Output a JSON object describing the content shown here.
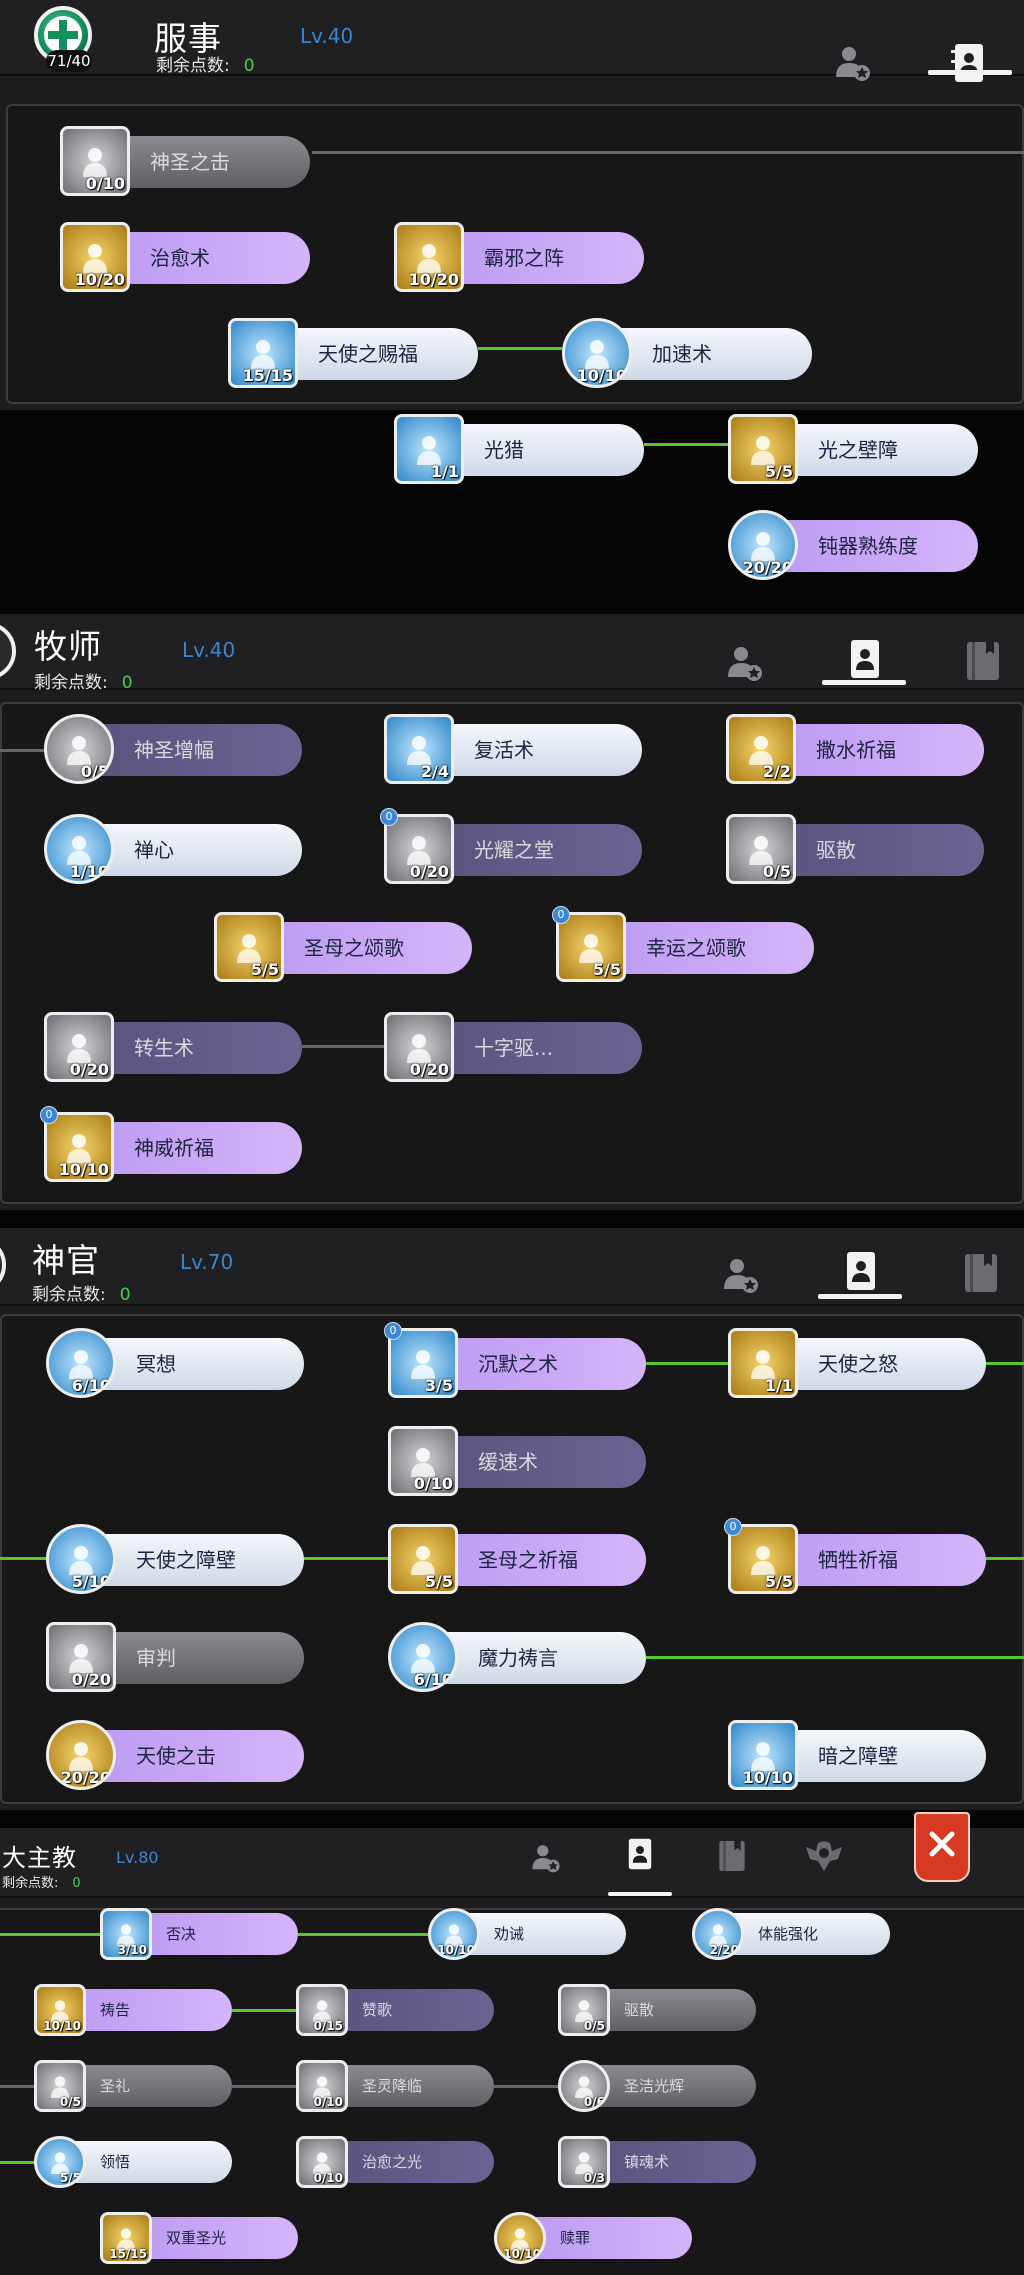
{
  "panels": [
    {
      "title": "服事",
      "level": "Lv.40",
      "points_label": "剩余点数:",
      "points": "0",
      "avatar_count": "71/40"
    },
    {
      "title": "牧师",
      "level": "Lv.40",
      "points_label": "剩余点数:",
      "points": "0"
    },
    {
      "title": "神官",
      "level": "Lv.70",
      "points_label": "剩余点数:",
      "points": "0"
    },
    {
      "title": "大主教",
      "level": "Lv.80",
      "points_label": "剩余点数:",
      "points": "0"
    }
  ],
  "skills": {
    "p1": [
      {
        "name": "神圣之击",
        "level": "0/10"
      },
      {
        "name": "治愈术",
        "level": "10/20"
      },
      {
        "name": "霸邪之阵",
        "level": "10/20"
      },
      {
        "name": "天使之赐福",
        "level": "15/15"
      },
      {
        "name": "加速术",
        "level": "10/10"
      },
      {
        "name": "光猎",
        "level": "1/1"
      },
      {
        "name": "光之壁障",
        "level": "5/5"
      },
      {
        "name": "钝器熟练度",
        "level": "20/20"
      }
    ],
    "p2": [
      {
        "name": "神圣增幅",
        "level": "0/5"
      },
      {
        "name": "复活术",
        "level": "2/4"
      },
      {
        "name": "撒水祈福",
        "level": "2/2"
      },
      {
        "name": "禅心",
        "level": "1/10"
      },
      {
        "name": "光耀之堂",
        "level": "0/20"
      },
      {
        "name": "驱散",
        "level": "0/5"
      },
      {
        "name": "圣母之颂歌",
        "level": "5/5"
      },
      {
        "name": "幸运之颂歌",
        "level": "5/5"
      },
      {
        "name": "转生术",
        "level": "0/20"
      },
      {
        "name": "十字驱...",
        "level": "0/20"
      },
      {
        "name": "神威祈福",
        "level": "10/10"
      }
    ],
    "p3": [
      {
        "name": "冥想",
        "level": "6/10"
      },
      {
        "name": "沉默之术",
        "level": "3/5"
      },
      {
        "name": "天使之怒",
        "level": "1/1"
      },
      {
        "name": "缓速术",
        "level": "0/10"
      },
      {
        "name": "天使之障壁",
        "level": "5/10"
      },
      {
        "name": "圣母之祈福",
        "level": "5/5"
      },
      {
        "name": "牺牲祈福",
        "level": "5/5"
      },
      {
        "name": "审判",
        "level": "0/20"
      },
      {
        "name": "魔力祷言",
        "level": "6/10"
      },
      {
        "name": "天使之击",
        "level": "20/20"
      },
      {
        "name": "暗之障壁",
        "level": "10/10"
      }
    ],
    "p4": [
      {
        "name": "否决",
        "level": "3/10"
      },
      {
        "name": "劝诫",
        "level": "10/10"
      },
      {
        "name": "体能强化",
        "level": "2/20"
      },
      {
        "name": "祷告",
        "level": "10/10"
      },
      {
        "name": "赞歌",
        "level": "0/15"
      },
      {
        "name": "驱散",
        "level": "0/5"
      },
      {
        "name": "圣礼",
        "level": "0/5"
      },
      {
        "name": "圣灵降临",
        "level": "0/10"
      },
      {
        "name": "圣洁光辉",
        "level": "0/6"
      },
      {
        "name": "领悟",
        "level": "5/5"
      },
      {
        "name": "治愈之光",
        "level": "0/10"
      },
      {
        "name": "镇魂术",
        "level": "0/3"
      },
      {
        "name": "双重圣光",
        "level": "15/15"
      },
      {
        "name": "赎罪",
        "level": "10/10"
      }
    ]
  },
  "icon_badge": "0",
  "icons": {
    "tab_friend": "friend-star-icon",
    "tab_skill": "skill-book-icon",
    "tab_book": "book-icon",
    "tab_guild": "guild-emblem-icon",
    "close": "close-icon"
  },
  "colors": {
    "purple_pill": "#c8a8f2",
    "white_pill": "#e9eef6",
    "gray_pill": "#7a7a80",
    "accent_blue": "#3c86ce",
    "points_green": "#46d04f",
    "link_green": "#58c62d"
  }
}
